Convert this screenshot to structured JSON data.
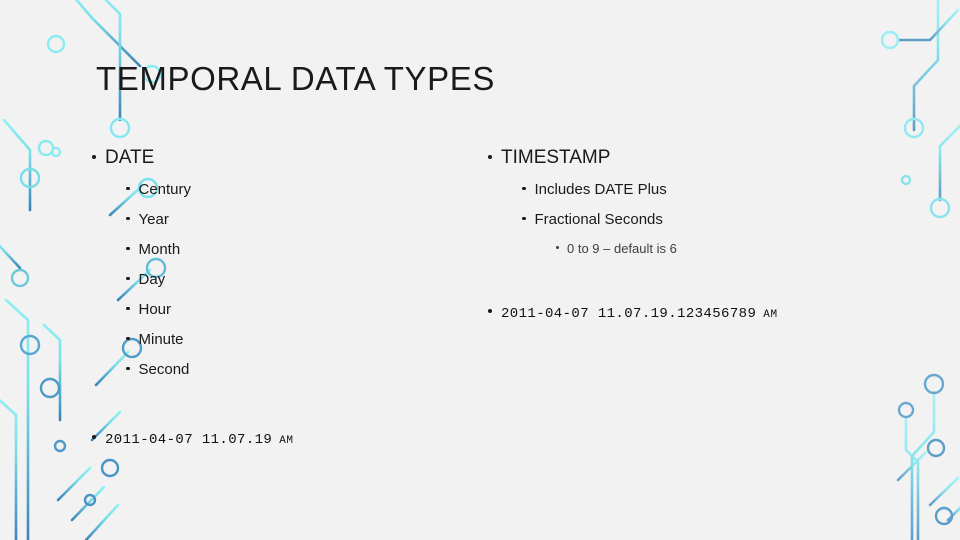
{
  "slide": {
    "title": "TEMPORAL DATA TYPES",
    "background_color": "#f2f2f2",
    "text_color": "#1a1a1a",
    "accent_cyan": "#7fe6ed",
    "accent_blue": "#4a90bf"
  },
  "left_column": {
    "heading": "DATE",
    "items": [
      {
        "label": "Century"
      },
      {
        "label": "Year"
      },
      {
        "label": "Month"
      },
      {
        "label": "Day"
      },
      {
        "label": "Hour"
      },
      {
        "label": "Minute"
      },
      {
        "label": "Second"
      }
    ],
    "example": {
      "value": "2011-04-07 11.07.19",
      "suffix": "AM"
    }
  },
  "right_column": {
    "heading": "TIMESTAMP",
    "items": [
      {
        "label": "Includes DATE Plus"
      },
      {
        "label": "Fractional Seconds"
      }
    ],
    "note": "0 to 9 – default is 6",
    "example": {
      "value": "2011-04-07 11.07.19.123456789",
      "suffix": "AM"
    }
  },
  "decoration": {
    "name": "circuit-board-traces"
  }
}
